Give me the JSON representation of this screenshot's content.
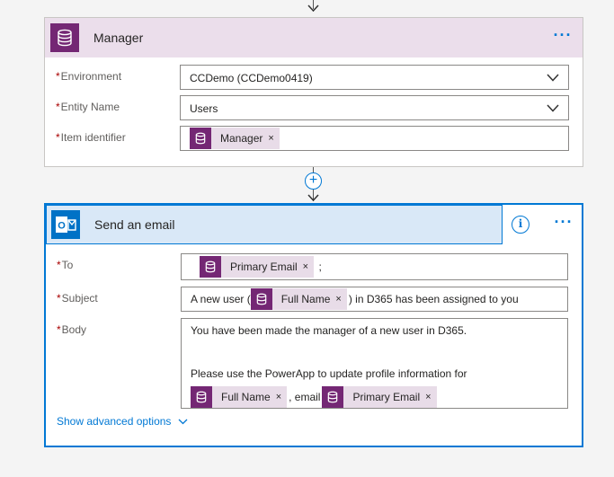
{
  "connectors": {
    "add_step_symbol": "+"
  },
  "manager_card": {
    "title": "Manager",
    "more_label": "···",
    "required_marker": "*",
    "fields": {
      "environment": {
        "label": "Environment",
        "value": "CCDemo (CCDemo0419)"
      },
      "entity_name": {
        "label": "Entity Name",
        "value": "Users"
      },
      "item_identifier": {
        "label": "Item identifier",
        "token": "Manager",
        "token_remove": "×"
      }
    }
  },
  "email_card": {
    "title": "Send an email",
    "info_label": "i",
    "more_label": "···",
    "required_marker": "*",
    "fields": {
      "to": {
        "label": "To",
        "token": "Primary Email",
        "token_remove": "×",
        "suffix": ";"
      },
      "subject": {
        "label": "Subject",
        "prefix": "A new user (",
        "token": "Full Name",
        "token_remove": "×",
        "suffix": ") in D365 has been assigned to you"
      },
      "body": {
        "label": "Body",
        "line1": "You have been made the manager of a new user in D365.",
        "line2": "Please use the PowerApp to update profile information for",
        "token1": "Full Name",
        "token1_remove": "×",
        "separator": ", email",
        "token2": "Primary Email",
        "token2_remove": "×"
      }
    },
    "advanced_options": "Show advanced options"
  },
  "colors": {
    "accent": "#0078d4",
    "cds_purple": "#742774",
    "manager_header_bg": "#ebdeeb",
    "email_header_bg": "#d9e8f7",
    "token_bg": "#e8dce8",
    "required": "#a80000"
  },
  "icons": {
    "cds": "database-icon",
    "outlook": "outlook-icon"
  }
}
